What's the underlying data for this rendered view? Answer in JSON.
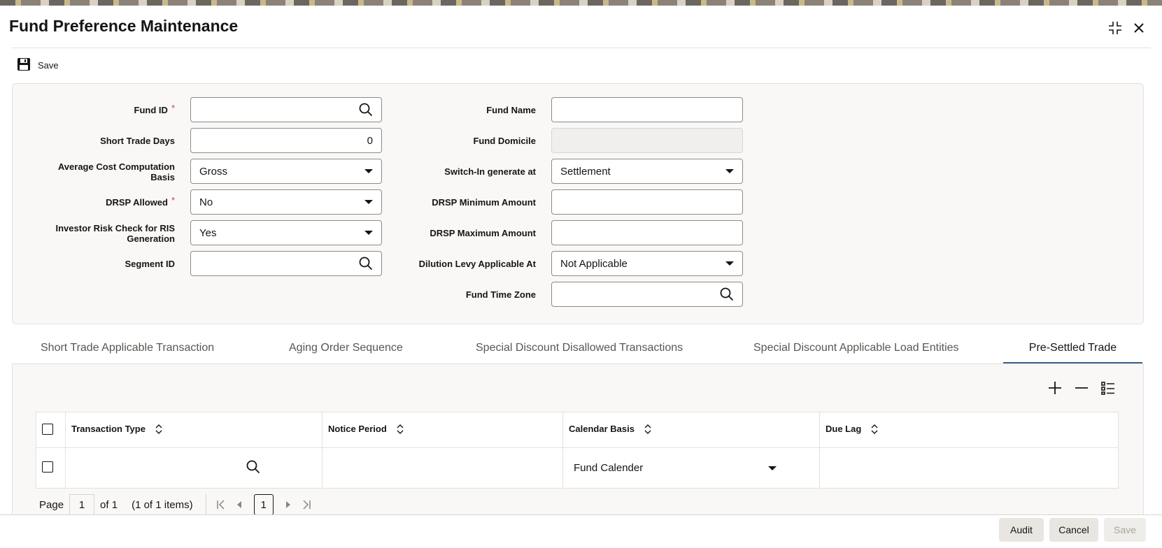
{
  "window": {
    "title": "Fund Preference Maintenance"
  },
  "toolbar": {
    "save_label": "Save"
  },
  "form": {
    "fund_id": {
      "label": "Fund ID",
      "required": "*",
      "value": ""
    },
    "short_trade_days": {
      "label": "Short Trade Days",
      "value": "0"
    },
    "avg_cost_basis": {
      "label_line1": "Average Cost Computation",
      "label_line2": "Basis",
      "value": "Gross"
    },
    "drsp_allowed": {
      "label": "DRSP Allowed",
      "required": "*",
      "value": "No"
    },
    "investor_risk_check": {
      "label_line1": "Investor Risk Check for RIS",
      "label_line2": "Generation",
      "value": "Yes"
    },
    "segment_id": {
      "label": "Segment ID",
      "value": ""
    },
    "fund_name": {
      "label": "Fund Name",
      "value": ""
    },
    "fund_domicile": {
      "label": "Fund Domicile",
      "value": ""
    },
    "switch_in_generate_at": {
      "label": "Switch-In generate at",
      "value": "Settlement"
    },
    "drsp_min_amount": {
      "label": "DRSP Minimum Amount",
      "value": ""
    },
    "drsp_max_amount": {
      "label": "DRSP Maximum Amount",
      "value": ""
    },
    "dilution_levy": {
      "label": "Dilution Levy Applicable At",
      "value": "Not Applicable"
    },
    "fund_time_zone": {
      "label": "Fund Time Zone",
      "value": ""
    }
  },
  "tabs": [
    {
      "label": "Short Trade Applicable Transaction"
    },
    {
      "label": "Aging Order Sequence"
    },
    {
      "label": "Special Discount Disallowed Transactions"
    },
    {
      "label": "Special Discount Applicable Load Entities"
    },
    {
      "label": "Pre-Settled Trade"
    }
  ],
  "grid": {
    "columns": [
      "Transaction Type",
      "Notice Period",
      "Calendar Basis",
      "Due Lag"
    ],
    "rows": [
      {
        "transaction_type": "",
        "notice_period": "",
        "calendar_basis": "Fund Calender",
        "due_lag": ""
      }
    ]
  },
  "pagination": {
    "page_label": "Page",
    "page": "1",
    "of_label": "of 1",
    "items_label": "(1 of 1 items)",
    "current": "1"
  },
  "footer": {
    "audit": "Audit",
    "cancel": "Cancel",
    "save": "Save"
  }
}
